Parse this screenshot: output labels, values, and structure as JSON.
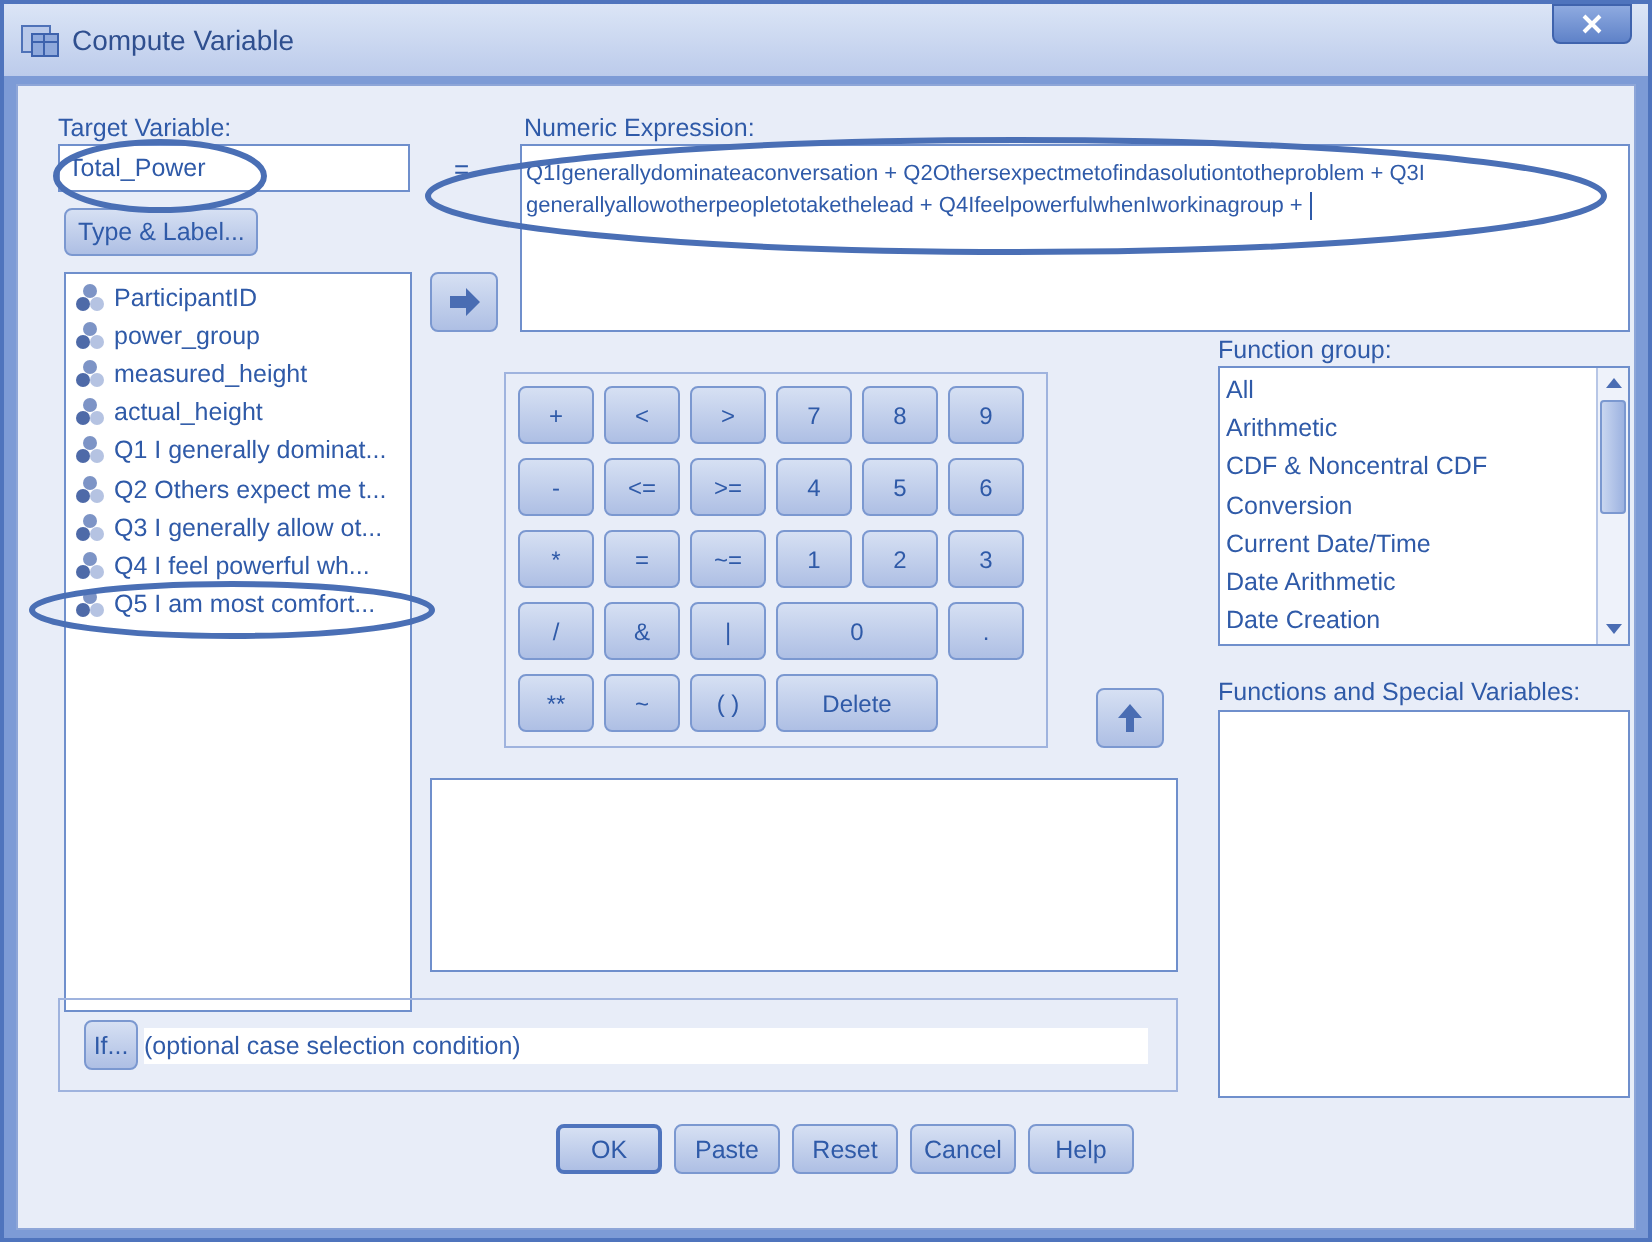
{
  "window": {
    "title": "Compute Variable"
  },
  "target_variable": {
    "label": "Target Variable:",
    "value": "Total_Power"
  },
  "equals_sign": "=",
  "type_label_button": "Type & Label...",
  "variables": [
    "ParticipantID",
    "power_group",
    "measured_height",
    "actual_height",
    "Q1 I generally dominat...",
    "Q2 Others expect me t...",
    "Q3 I generally allow ot...",
    "Q4 I feel powerful wh...",
    "Q5 I am most comfort..."
  ],
  "numeric_expression": {
    "label": "Numeric Expression:",
    "lines": [
      "Q1Igenerallydominateaconversation +  Q2Othersexpectmetofindasolutiontotheproblem + Q3I",
      "generallyallowotherpeopletotakethelead + Q4IfeelpowerfulwhenIworkinagroup +"
    ],
    "cursor": true
  },
  "keypad": [
    {
      "label": "+",
      "kind": "key"
    },
    {
      "label": "<",
      "kind": "key"
    },
    {
      "label": ">",
      "kind": "key"
    },
    {
      "label": "7",
      "kind": "key"
    },
    {
      "label": "8",
      "kind": "key"
    },
    {
      "label": "9",
      "kind": "key"
    },
    {
      "label": "-",
      "kind": "key"
    },
    {
      "label": "<=",
      "kind": "key"
    },
    {
      "label": ">=",
      "kind": "key"
    },
    {
      "label": "4",
      "kind": "key"
    },
    {
      "label": "5",
      "kind": "key"
    },
    {
      "label": "6",
      "kind": "key"
    },
    {
      "label": "*",
      "kind": "key"
    },
    {
      "label": "=",
      "kind": "key"
    },
    {
      "label": "~=",
      "kind": "key"
    },
    {
      "label": "1",
      "kind": "key"
    },
    {
      "label": "2",
      "kind": "key"
    },
    {
      "label": "3",
      "kind": "key"
    },
    {
      "label": "/",
      "kind": "key"
    },
    {
      "label": "&",
      "kind": "key"
    },
    {
      "label": "|",
      "kind": "key"
    },
    {
      "label": "0",
      "kind": "wide"
    },
    {
      "label": ".",
      "kind": "key"
    },
    {
      "label": "**",
      "kind": "key"
    },
    {
      "label": "~",
      "kind": "key"
    },
    {
      "label": "( )",
      "kind": "key"
    },
    {
      "label": "Delete",
      "kind": "wide"
    }
  ],
  "function_group": {
    "label": "Function group:",
    "items": [
      "All",
      "Arithmetic",
      "CDF & Noncentral CDF",
      "Conversion",
      "Current Date/Time",
      "Date Arithmetic",
      "Date Creation"
    ]
  },
  "functions_and_special_variables": {
    "label": "Functions and Special Variables:"
  },
  "if_button": "If...",
  "case_selection": "(optional case selection condition)",
  "buttons": [
    {
      "label": "OK",
      "default": true
    },
    {
      "label": "Paste",
      "default": false
    },
    {
      "label": "Reset",
      "default": false
    },
    {
      "label": "Cancel",
      "default": false
    },
    {
      "label": "Help",
      "default": false
    }
  ]
}
